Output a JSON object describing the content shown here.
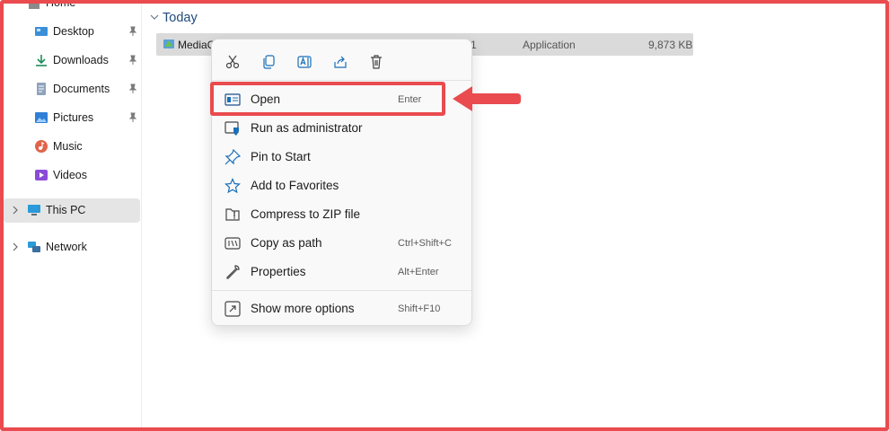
{
  "sidebar": {
    "home_label": "Home",
    "items": [
      {
        "label": "Desktop",
        "icon": "desktop-icon"
      },
      {
        "label": "Downloads",
        "icon": "downloads-icon"
      },
      {
        "label": "Documents",
        "icon": "documents-icon"
      },
      {
        "label": "Pictures",
        "icon": "pictures-icon"
      },
      {
        "label": "Music",
        "icon": "music-icon"
      },
      {
        "label": "Videos",
        "icon": "videos-icon"
      }
    ],
    "this_pc_label": "This PC",
    "network_label": "Network"
  },
  "content": {
    "group_title": "Today",
    "file": {
      "name": "MediaC",
      "date_fragment": "1",
      "type": "Application",
      "size": "9,873 KB"
    }
  },
  "context_menu": {
    "quick_actions": [
      "cut-icon",
      "copy-icon",
      "rename-icon",
      "share-icon",
      "delete-icon"
    ],
    "items": [
      {
        "label": "Open",
        "shortcut": "Enter"
      },
      {
        "label": "Run as administrator",
        "shortcut": ""
      },
      {
        "label": "Pin to Start",
        "shortcut": ""
      },
      {
        "label": "Add to Favorites",
        "shortcut": ""
      },
      {
        "label": "Compress to ZIP file",
        "shortcut": ""
      },
      {
        "label": "Copy as path",
        "shortcut": "Ctrl+Shift+C"
      },
      {
        "label": "Properties",
        "shortcut": "Alt+Enter"
      }
    ],
    "more": {
      "label": "Show more options",
      "shortcut": "Shift+F10"
    }
  },
  "colors": {
    "annotation": "#e94b4f",
    "accent": "#0067c0",
    "selection": "#dadada"
  }
}
